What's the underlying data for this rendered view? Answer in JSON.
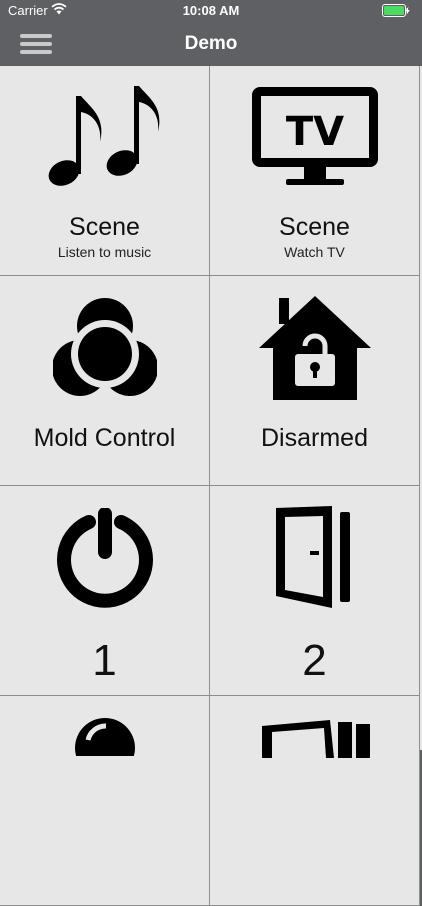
{
  "status_bar": {
    "carrier": "Carrier",
    "time": "10:08 AM"
  },
  "nav": {
    "title": "Demo"
  },
  "tiles": [
    {
      "title": "Scene",
      "subtitle": "Listen to music",
      "icon": "music-notes-icon"
    },
    {
      "title": "Scene",
      "subtitle": "Watch TV",
      "icon": "tv-icon",
      "icon_text": "TV"
    },
    {
      "title": "Mold Control",
      "icon": "mold-control-icon"
    },
    {
      "title": "Disarmed",
      "icon": "house-unlocked-icon"
    },
    {
      "title": "1",
      "icon": "power-icon"
    },
    {
      "title": "2",
      "icon": "door-icon"
    },
    {
      "title": "",
      "icon": "bulb-icon"
    },
    {
      "title": "",
      "icon": "window-icon"
    }
  ],
  "colors": {
    "bar": "#5e6063",
    "tile": "#e7e7e7",
    "border": "#8e8e8e",
    "battery": "#4cd964"
  }
}
